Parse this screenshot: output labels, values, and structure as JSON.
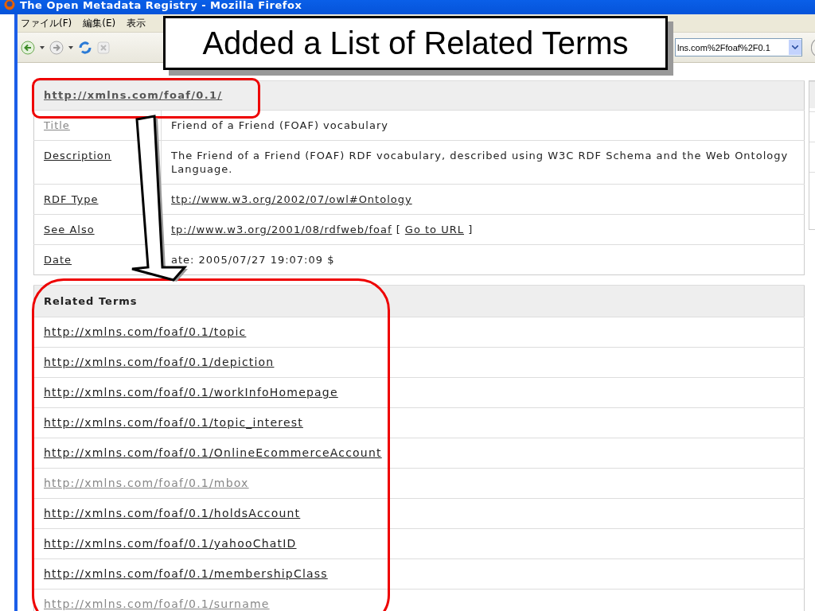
{
  "window": {
    "title": "The Open Metadata Registry - Mozilla Firefox"
  },
  "menu": [
    {
      "label": "ファイル(F)"
    },
    {
      "label": "編集(E)"
    },
    {
      "label": "表示"
    }
  ],
  "toolbar": {
    "address": "lns.com%2Ffoaf%2F0.1"
  },
  "record": {
    "header": "http://xmlns.com/foaf/0.1/",
    "fields": [
      {
        "label": "Title",
        "visited": true,
        "parts": [
          {
            "text": "Friend of a Friend (FOAF) vocabulary",
            "kind": "text"
          }
        ]
      },
      {
        "label": "Description",
        "visited": false,
        "parts": [
          {
            "text": "The Friend of a Friend (FOAF) RDF vocabulary, described using W3C RDF Schema and the Web Ontology Language.",
            "kind": "text"
          }
        ]
      },
      {
        "label": "RDF Type",
        "visited": false,
        "parts": [
          {
            "text": "ttp://www.w3.org/2002/07/owl#Ontology",
            "kind": "link"
          }
        ]
      },
      {
        "label": "See Also",
        "visited": false,
        "parts": [
          {
            "text": "tp://www.w3.org/2001/08/rdfweb/foaf",
            "kind": "link"
          },
          {
            "text": "[",
            "kind": "text"
          },
          {
            "text": "Go to URL",
            "kind": "link"
          },
          {
            "text": "]",
            "kind": "text"
          }
        ]
      },
      {
        "label": "Date",
        "visited": false,
        "parts": [
          {
            "text": "ate: 2005/07/27 19:07:09 $",
            "kind": "text"
          }
        ]
      }
    ]
  },
  "related_terms": {
    "title": "Related Terms",
    "items": [
      {
        "url": "http://xmlns.com/foaf/0.1/topic",
        "visited": false
      },
      {
        "url": "http://xmlns.com/foaf/0.1/depiction",
        "visited": false
      },
      {
        "url": "http://xmlns.com/foaf/0.1/workInfoHomepage",
        "visited": false
      },
      {
        "url": "http://xmlns.com/foaf/0.1/topic_interest",
        "visited": false
      },
      {
        "url": "http://xmlns.com/foaf/0.1/OnlineEcommerceAccount",
        "visited": false
      },
      {
        "url": "http://xmlns.com/foaf/0.1/mbox",
        "visited": true
      },
      {
        "url": "http://xmlns.com/foaf/0.1/holdsAccount",
        "visited": false
      },
      {
        "url": "http://xmlns.com/foaf/0.1/yahooChatID",
        "visited": false
      },
      {
        "url": "http://xmlns.com/foaf/0.1/membershipClass",
        "visited": false
      },
      {
        "url": "http://xmlns.com/foaf/0.1/surname",
        "visited": true
      }
    ]
  },
  "annotation": {
    "callout": "Added a List of Related Terms"
  }
}
